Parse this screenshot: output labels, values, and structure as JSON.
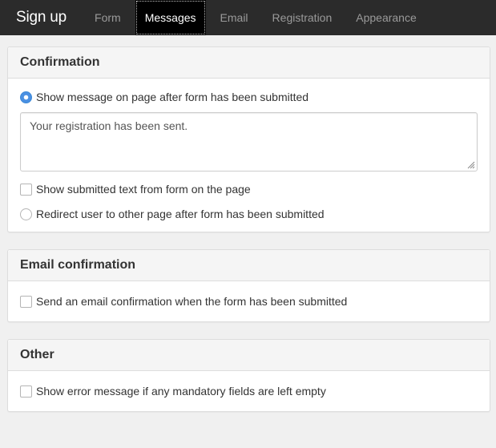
{
  "app": {
    "title": "Sign up"
  },
  "nav": {
    "tabs": [
      {
        "label": "Form"
      },
      {
        "label": "Messages",
        "active": true
      },
      {
        "label": "Email"
      },
      {
        "label": "Registration"
      },
      {
        "label": "Appearance"
      }
    ]
  },
  "confirmation": {
    "heading": "Confirmation",
    "show_message_label": "Show message on page after form has been submitted",
    "show_message_selected": true,
    "message_text": "Your registration has been sent.",
    "show_submitted_label": "Show submitted text from form on the page",
    "show_submitted_checked": false,
    "redirect_label": "Redirect user to other page after form has been submitted",
    "redirect_selected": false
  },
  "email_confirmation": {
    "heading": "Email confirmation",
    "send_label": "Send an email confirmation when the form has been submitted",
    "send_checked": false
  },
  "other": {
    "heading": "Other",
    "error_label": "Show error message if any mandatory fields are left empty",
    "error_checked": false
  },
  "colors": {
    "navbar": "#2b2b2b",
    "accent": "#4a90e2",
    "background": "#f0f0f0"
  }
}
